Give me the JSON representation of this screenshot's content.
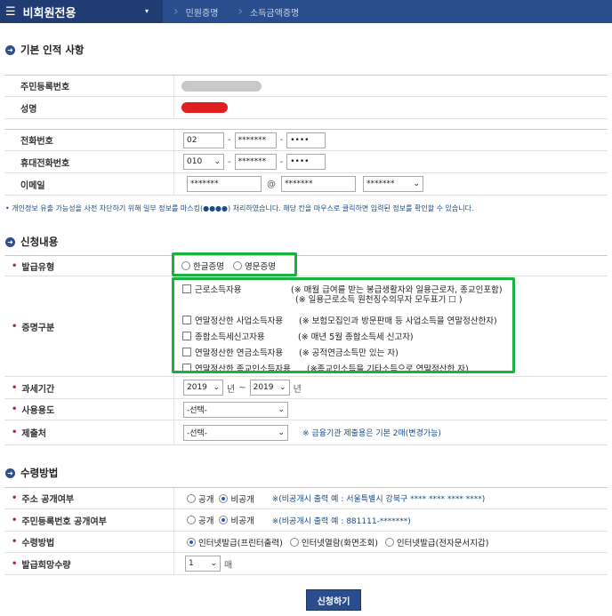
{
  "topbar": {
    "menu_icon": "hamburger-icon",
    "menu_label": "비회원전용",
    "caret": "▾",
    "crumbs": [
      "민원증명",
      "소득금액증명"
    ]
  },
  "section_basic": {
    "title": "기본 인적 사항"
  },
  "basic": {
    "rrn_label": "주민등록번호",
    "name_label": "성명",
    "phone_label": "전화번호",
    "phone_1": "02",
    "phone_2": "*******",
    "phone_3": "••••",
    "mobile_label": "휴대전화번호",
    "mobile_1": "010",
    "mobile_2": "*******",
    "mobile_3": "••••",
    "email_label": "이메일",
    "email_1": "*******",
    "email_at": "@",
    "email_2": "*******",
    "email_3": "*******"
  },
  "privacy_note": "• 개인정보 유출 가능성을 사전 차단하기 위해 일부 정보를 마스킹(●●●●) 처리하였습니다. 해당 칸을 마우스로 클릭하면 입력된 정보를 확인할 수 있습니다.",
  "section_apply": {
    "title": "신청내용"
  },
  "apply": {
    "type_label": "발급유형",
    "type_opt1": "한글증명",
    "type_opt2": "영문증명",
    "kind_label": "증명구분",
    "kinds": [
      {
        "label": "근로소득자용",
        "desc": "(※ 매월 급여를 받는 봉급생활자와 일용근로자, 종교인포함)"
      },
      {
        "label": "",
        "desc": "(※ 일용근로소득 원천징수의무자 모두표기 ☐ )"
      },
      {
        "label": "연말정산한 사업소득자용",
        "desc": "(※ 보험모집인과 방문판매 등 사업소득을 연말정산한자)"
      },
      {
        "label": "종합소득세신고자용",
        "desc": "(※ 매년 5월 종합소득세 신고자)"
      },
      {
        "label": "연말정산한 연금소득자용",
        "desc": "(※ 공적연금소득만 있는 자)"
      },
      {
        "label": "연말정산한 종교인소득자용",
        "desc": "(※종교인소득을 기타소득으로 연말정산한 자)"
      }
    ],
    "period_label": "과세기간",
    "year_from": "2019",
    "year_unit1": "년",
    "tilde": "~",
    "year_to": "2019",
    "year_unit2": "년",
    "usage_label": "사용용도",
    "usage_value": "-선택-",
    "submit_to_label": "제출처",
    "submit_to_value": "-선택-",
    "submit_note": "※ 금융기관 제출용은 기본 2매(변경가능)"
  },
  "section_receive": {
    "title": "수령방법"
  },
  "receive": {
    "addr_label": "주소 공개여부",
    "addr_opt1": "공개",
    "addr_opt2": "비공개",
    "addr_note": "※(비공개시 출력 예 : 서울특별시 강북구 **** **** **** ****)",
    "rrn_label": "주민등록번호 공개여부",
    "rrn_opt1": "공개",
    "rrn_opt2": "비공개",
    "rrn_note": "※(비공개시 출력 예 : 881111-*******)",
    "method_label": "수령방법",
    "method_opt1": "인터넷발급(프린터출력)",
    "method_opt2": "인터넷열람(화면조회)",
    "method_opt3": "인터넷발급(전자문서지갑)",
    "qty_label": "발급희망수량",
    "qty_value": "1",
    "qty_unit": "매"
  },
  "apply_button": "신청하기"
}
